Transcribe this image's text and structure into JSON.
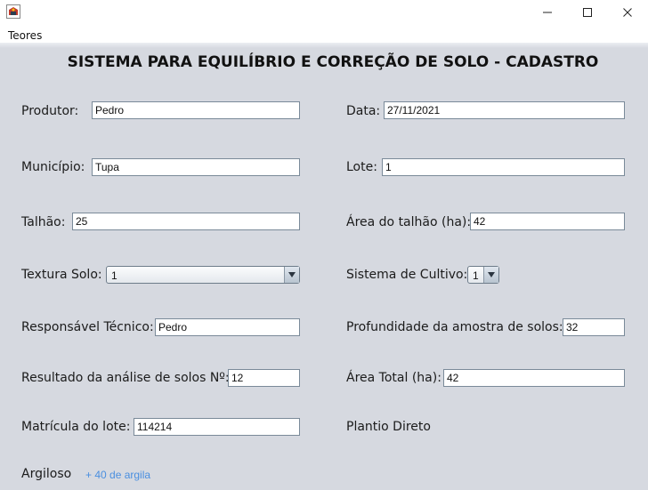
{
  "window": {
    "icon": "java-cup-icon",
    "controls": [
      "minimize-icon",
      "maximize-icon",
      "close-icon"
    ]
  },
  "menu": {
    "items": [
      "Teores"
    ]
  },
  "heading": "SISTEMA PARA EQUILÍBRIO E CORREÇÃO DE SOLO - CADASTRO",
  "form": {
    "produtor": {
      "label": "Produtor:",
      "value": "Pedro"
    },
    "data": {
      "label": "Data:",
      "value": "27/11/2021"
    },
    "municipio": {
      "label": "Município:",
      "value": "Tupa"
    },
    "lote": {
      "label": "Lote:",
      "value": "1"
    },
    "talhao": {
      "label": "Talhão:",
      "value": "25"
    },
    "area_talhao": {
      "label": "Área do talhão (ha):",
      "value": "42"
    },
    "textura_solo": {
      "label": "Textura Solo:",
      "value": "1"
    },
    "sistema_cultivo": {
      "label": "Sistema de Cultivo:",
      "value": "1"
    },
    "responsavel": {
      "label": "Responsável Técnico:",
      "value": "Pedro"
    },
    "profundidade": {
      "label": "Profundidade da amostra de solos:",
      "value": "32"
    },
    "resultado": {
      "label": "Resultado da análise de solos Nº:",
      "value": "12"
    },
    "area_total": {
      "label": "Área Total (ha):",
      "value": "42"
    },
    "matricula": {
      "label": "Matrícula do lote:",
      "value": "114214"
    }
  },
  "info": {
    "cultivo_text": "Plantio Direto",
    "textura_text": "Argiloso",
    "textura_note": "+ 40 de argila",
    "note_color": "#4a8fe0"
  }
}
